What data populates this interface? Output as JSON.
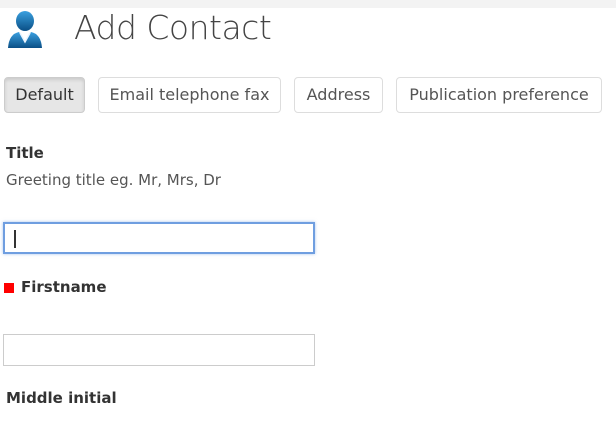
{
  "header": {
    "title": "Add Contact",
    "icon": "contact-person-icon"
  },
  "tabs": [
    {
      "label": "Default",
      "active": true
    },
    {
      "label": "Email telephone fax"
    },
    {
      "label": "Address"
    },
    {
      "label": "Publication preference"
    }
  ],
  "fields": {
    "title": {
      "label": "Title",
      "help": "Greeting title eg. Mr, Mrs, Dr",
      "value": ""
    },
    "firstname": {
      "label": "Firstname",
      "required": true,
      "value": ""
    },
    "middle_initial": {
      "label": "Middle initial"
    }
  },
  "colors": {
    "required": "#ff0000",
    "focus": "#6f9ee0"
  }
}
